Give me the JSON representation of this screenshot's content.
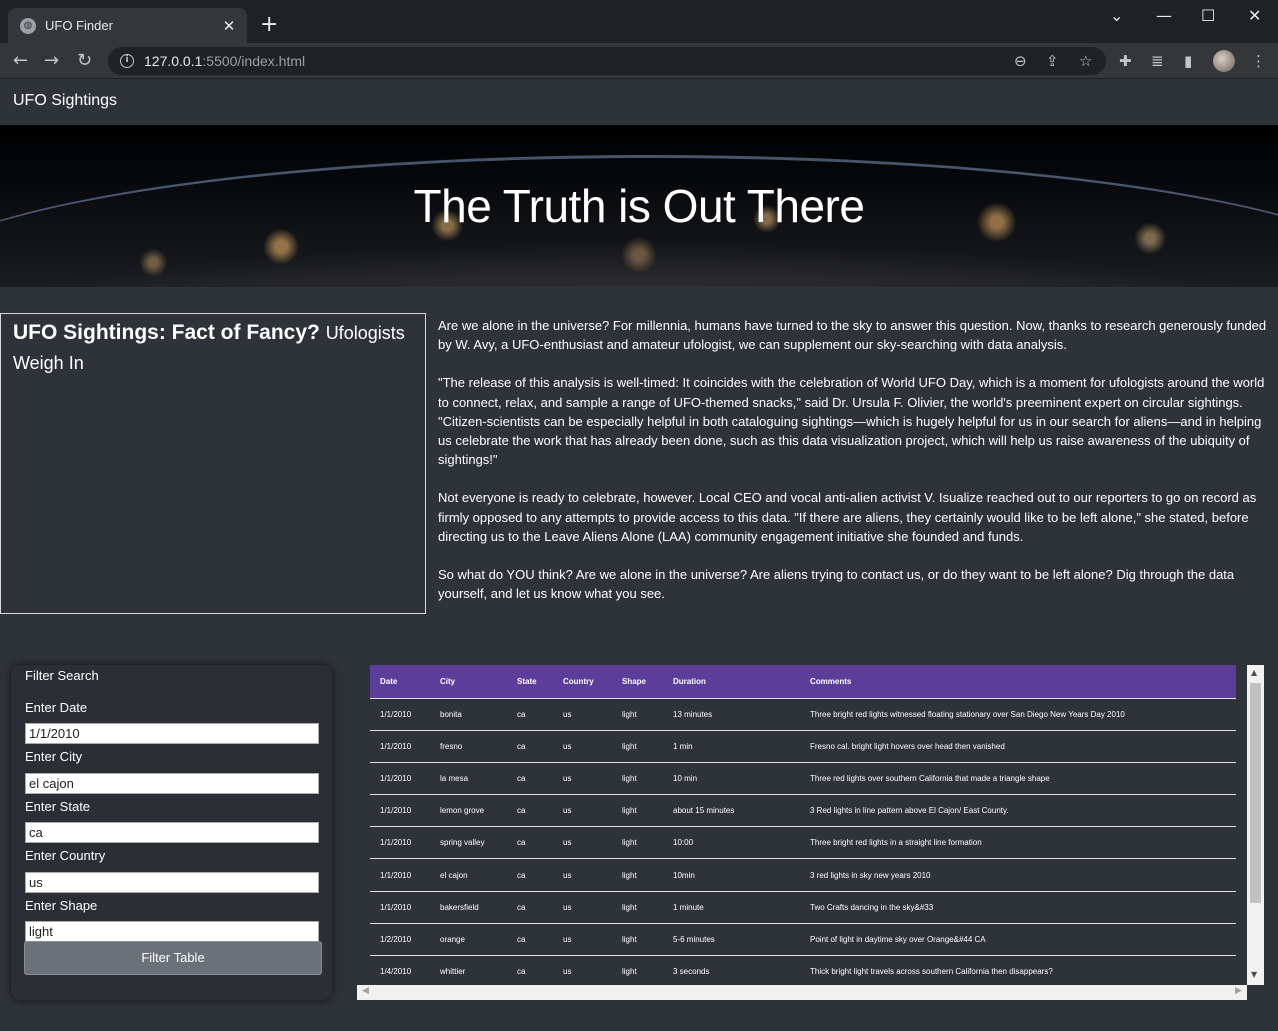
{
  "browser": {
    "tab_title": "UFO Finder",
    "url_host": "127.0.0.1",
    "url_path": ":5500/index.html"
  },
  "navbar": {
    "brand": "UFO Sightings"
  },
  "hero": {
    "title": "The Truth is Out There"
  },
  "card": {
    "title": "UFO Sightings: Fact of Fancy?",
    "subtitle": "Ufologists Weigh In"
  },
  "article": {
    "paragraphs": [
      "Are we alone in the universe? For millennia, humans have turned to the sky to answer this question. Now, thanks to research generously funded by W. Avy, a UFO-enthusiast and amateur ufologist, we can supplement our sky-searching with data analysis.",
      "\"The release of this analysis is well-timed: It coincides with the celebration of World UFO Day, which is a moment for ufologists around the world to connect, relax, and sample a range of UFO-themed snacks,\" said Dr. Ursula F. Olivier, the world's preeminent expert on circular sightings. \"Citizen-scientists can be especially helpful in both cataloguing sightings—which is hugely helpful for us in our search for aliens—and in helping us celebrate the work that has already been done, such as this data visualization project, which will help us raise awareness of the ubiquity of sightings!\"",
      "Not everyone is ready to celebrate, however. Local CEO and vocal anti-alien activist V. Isualize reached out to our reporters to go on record as firmly opposed to any attempts to provide access to this data. \"If there are aliens, they certainly would like to be left alone,\" she stated, before directing us to the Leave Aliens Alone (LAA) community engagement initiative she founded and funds.",
      "So what do YOU think? Are we alone in the universe? Are aliens trying to contact us, or do they want to be left alone? Dig through the data yourself, and let us know what you see."
    ]
  },
  "filter": {
    "title": "Filter Search",
    "date_label": "Enter Date",
    "date_value": "1/1/2010",
    "city_label": "Enter City",
    "city_value": "el cajon",
    "state_label": "Enter State",
    "state_value": "ca",
    "country_label": "Enter Country",
    "country_value": "us",
    "shape_label": "Enter Shape",
    "shape_value": "light",
    "button": "Filter Table"
  },
  "table": {
    "headers": [
      "Date",
      "City",
      "State",
      "Country",
      "Shape",
      "Duration",
      "Comments"
    ],
    "rows": [
      [
        "1/1/2010",
        "bonita",
        "ca",
        "us",
        "light",
        "13 minutes",
        "Three bright red lights witnessed floating stationary over San Diego New Years Day 2010"
      ],
      [
        "1/1/2010",
        "fresno",
        "ca",
        "us",
        "light",
        "1 min",
        "Fresno cal. bright light hovers over head then vanished"
      ],
      [
        "1/1/2010",
        "la mesa",
        "ca",
        "us",
        "light",
        "10 min",
        "Three red lights over southern California that made a triangle shape"
      ],
      [
        "1/1/2010",
        "lemon grove",
        "ca",
        "us",
        "light",
        "about 15 minutes",
        "3 Red lights in line pattern above El Cajon/ East County."
      ],
      [
        "1/1/2010",
        "spring valley",
        "ca",
        "us",
        "light",
        "10:00",
        "Three bright red lights in a straight line formation"
      ],
      [
        "1/1/2010",
        "el cajon",
        "ca",
        "us",
        "light",
        "10min",
        "3 red lights in sky new years 2010"
      ],
      [
        "1/1/2010",
        "bakersfield",
        "ca",
        "us",
        "light",
        "1 minute",
        "Two Crafts dancing in the sky&#33"
      ],
      [
        "1/2/2010",
        "orange",
        "ca",
        "us",
        "light",
        "5-6 minutes",
        "Point of light in daytime sky over Orange&#44 CA"
      ],
      [
        "1/4/2010",
        "whittier",
        "ca",
        "us",
        "light",
        "3 seconds",
        "Thick bright light travels across southern California then disappears?"
      ]
    ]
  }
}
